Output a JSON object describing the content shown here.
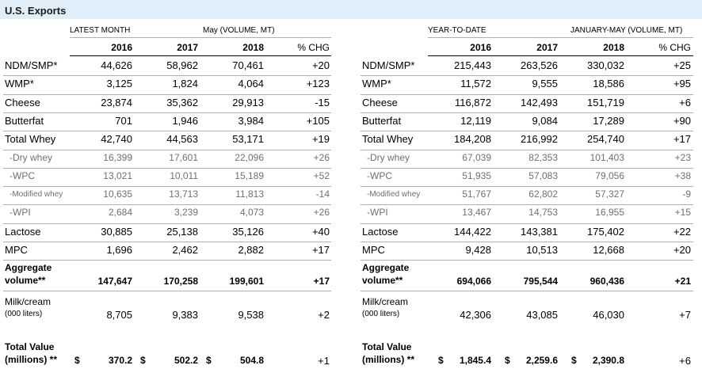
{
  "title": "U.S. Exports",
  "left": {
    "header1": "LATEST MONTH",
    "header2": "May (VOLUME, MT)",
    "years": [
      "2016",
      "2017",
      "2018"
    ],
    "chg_label": "% CHG"
  },
  "right": {
    "header1": "YEAR-TO-DATE",
    "header2": "JANUARY-MAY (VOLUME, MT)",
    "years": [
      "2016",
      "2017",
      "2018"
    ],
    "chg_label": "% CHG"
  },
  "rows": [
    {
      "label": "NDM/SMP*",
      "left": [
        "44,626",
        "58,962",
        "70,461",
        "+20"
      ],
      "right": [
        "215,443",
        "263,526",
        "330,032",
        "+25"
      ]
    },
    {
      "label": "WMP*",
      "left": [
        "3,125",
        "1,824",
        "4,064",
        "+123"
      ],
      "right": [
        "11,572",
        "9,555",
        "18,586",
        "+95"
      ]
    },
    {
      "label": "Cheese",
      "left": [
        "23,874",
        "35,362",
        "29,913",
        "-15"
      ],
      "right": [
        "116,872",
        "142,493",
        "151,719",
        "+6"
      ]
    },
    {
      "label": "Butterfat",
      "left": [
        "701",
        "1,946",
        "3,984",
        "+105"
      ],
      "right": [
        "12,119",
        "9,084",
        "17,289",
        "+90"
      ]
    },
    {
      "label": "Total Whey",
      "left": [
        "42,740",
        "44,563",
        "53,171",
        "+19"
      ],
      "right": [
        "184,208",
        "216,992",
        "254,740",
        "+17"
      ]
    },
    {
      "label": "-Dry whey",
      "left": [
        "16,399",
        "17,601",
        "22,096",
        "+26"
      ],
      "right": [
        "67,039",
        "82,353",
        "101,403",
        "+23"
      ]
    },
    {
      "label": "-WPC",
      "left": [
        "13,021",
        "10,011",
        "15,189",
        "+52"
      ],
      "right": [
        "51,935",
        "57,083",
        "79,056",
        "+38"
      ]
    },
    {
      "label": "-Modified whey",
      "left": [
        "10,635",
        "13,713",
        "11,813",
        "-14"
      ],
      "right": [
        "51,767",
        "62,802",
        "57,327",
        "-9"
      ]
    },
    {
      "label": "-WPI",
      "left": [
        "2,684",
        "3,239",
        "4,073",
        "+26"
      ],
      "right": [
        "13,467",
        "14,753",
        "16,955",
        "+15"
      ]
    },
    {
      "label": "Lactose",
      "left": [
        "30,885",
        "25,138",
        "35,126",
        "+40"
      ],
      "right": [
        "144,422",
        "143,381",
        "175,402",
        "+22"
      ]
    },
    {
      "label": "MPC",
      "left": [
        "1,696",
        "2,462",
        "2,882",
        "+17"
      ],
      "right": [
        "9,428",
        "10,513",
        "12,668",
        "+20"
      ]
    }
  ],
  "aggregate": {
    "label_line1": "Aggregate",
    "label_line2": "volume**",
    "left": [
      "147,647",
      "170,258",
      "199,601",
      "+17"
    ],
    "right": [
      "694,066",
      "795,544",
      "960,436",
      "+21"
    ]
  },
  "milk": {
    "label_line1": "Milk/cream",
    "label_line2": "(000 liters)",
    "left": [
      "8,705",
      "9,383",
      "9,538",
      "+2"
    ],
    "right": [
      "42,306",
      "43,085",
      "46,030",
      "+7"
    ]
  },
  "total_value": {
    "label_line1": "Total Value",
    "label_line2": "(millions) **",
    "currency": "$",
    "left": [
      "370.2",
      "502.2",
      "504.8",
      "+1"
    ],
    "right": [
      "1,845.4",
      "2,259.6",
      "2,390.8",
      "+6"
    ]
  }
}
